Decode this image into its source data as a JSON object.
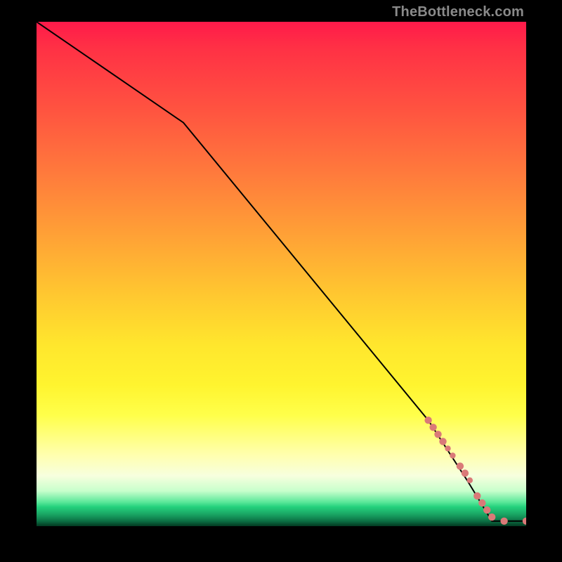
{
  "watermark": "TheBottleneck.com",
  "chart_data": {
    "type": "line",
    "title": "",
    "xlabel": "",
    "ylabel": "",
    "xlim": [
      0,
      100
    ],
    "ylim": [
      0,
      100
    ],
    "grid": false,
    "series": [
      {
        "name": "curve",
        "color": "#000000",
        "x": [
          0,
          30,
          80,
          88,
          93,
          100
        ],
        "y": [
          100,
          80,
          21,
          9,
          1,
          1
        ]
      }
    ],
    "markers": {
      "color": "#da7a78",
      "points": [
        {
          "x": 80.0,
          "y": 21.0,
          "r": 5.2
        },
        {
          "x": 81.0,
          "y": 19.6,
          "r": 5.2
        },
        {
          "x": 82.0,
          "y": 18.2,
          "r": 5.2
        },
        {
          "x": 83.0,
          "y": 16.8,
          "r": 5.2
        },
        {
          "x": 84.0,
          "y": 15.4,
          "r": 4.2
        },
        {
          "x": 85.0,
          "y": 14.0,
          "r": 4.2
        },
        {
          "x": 86.5,
          "y": 11.9,
          "r": 5.2
        },
        {
          "x": 87.5,
          "y": 10.5,
          "r": 5.2
        },
        {
          "x": 88.5,
          "y": 9.1,
          "r": 4.2
        },
        {
          "x": 90.0,
          "y": 6.0,
          "r": 5.2
        },
        {
          "x": 91.0,
          "y": 4.6,
          "r": 5.2
        },
        {
          "x": 92.0,
          "y": 3.2,
          "r": 5.2
        },
        {
          "x": 93.0,
          "y": 1.8,
          "r": 5.2
        },
        {
          "x": 95.5,
          "y": 1.0,
          "r": 5.2
        },
        {
          "x": 100.0,
          "y": 1.0,
          "r": 5.2
        }
      ]
    }
  }
}
